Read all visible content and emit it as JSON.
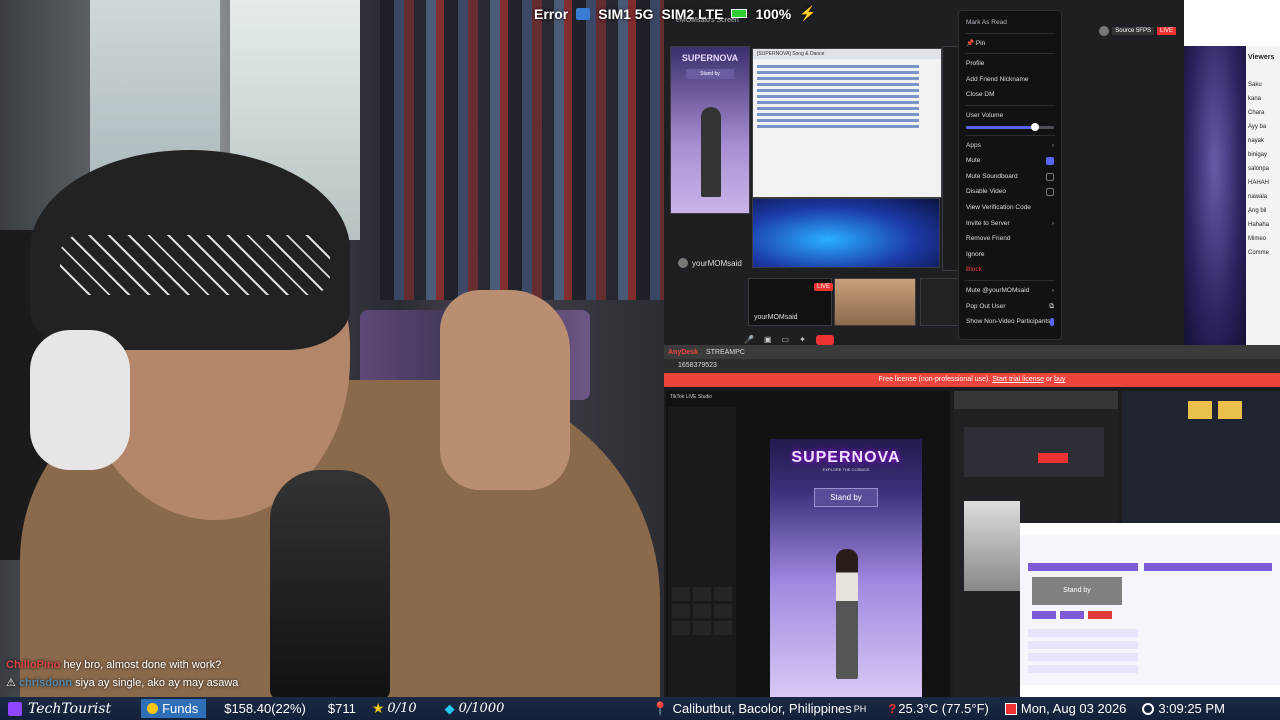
{
  "status_bar": {
    "error": "Error",
    "sim1": "SIM1 5G",
    "sim2": "SIM2 LTE",
    "battery": "100%",
    "screen_label": "eMOMsaid's Screen"
  },
  "chat": [
    {
      "user": "ChilloPino",
      "message": "hey bro, almost done with work?"
    },
    {
      "user": "chrisdonn",
      "message": "siya ay single, ako ay may asawa"
    }
  ],
  "discord": {
    "tile_phone_logo": "SUPERNOVA",
    "tile_phone_standby": "Stand by",
    "sheet_title": "[SUPERNOVA] Song & Dance",
    "participant_name": "yourMOMsaid",
    "participant_name_2": "yourMOMsaid",
    "live_badge": "LIVE",
    "source_badge": "Source 5FPS",
    "source_live": "LIVE",
    "context_menu": {
      "mark_as_read": "Mark As Read",
      "pin": "Pin",
      "profile": "Profile",
      "add_friend_nickname": "Add Friend Nickname",
      "close_dm": "Close DM",
      "user_volume": "User Volume",
      "user_volume_level": 0.78,
      "apps": "Apps",
      "mute": "Mute",
      "mute_soundboard": "Mute Soundboard",
      "disable_video": "Disable Video",
      "view_verification_code": "View Verification Code",
      "invite_to_server": "Invite to Server",
      "remove_friend": "Remove Friend",
      "ignore": "Ignore",
      "block": "Block",
      "mute_user": "Mute @yourMOMsaid",
      "pop_out_user": "Pop Out User",
      "show_non_video": "Show Non-Video Participants"
    }
  },
  "viewers": {
    "title": "Viewers",
    "names": [
      "Saku",
      "kana",
      "Chara",
      "Ayy ba",
      "nayak",
      "binigay",
      "salonpa",
      "HAHAH",
      "nawala",
      "Ang bil",
      "Hahaha",
      "Mimeo",
      "Comme"
    ]
  },
  "anydesk": {
    "app_name": "AnyDesk",
    "tab": "STREAMPC",
    "address": "1658379523",
    "banner_prefix": "Free license (non-professional use).",
    "banner_link": "Start trial license",
    "banner_or": "or",
    "banner_buy": "buy",
    "tiktok_title": "TikTok LIVE Studio",
    "supernova": "SUPERNOVA",
    "tagline": "EXPLORE THE COSMOS",
    "standby": "Stand by",
    "studio_standby": "Stand by"
  },
  "ticker": {
    "brand": "TechTourist",
    "funds_label": "Funds",
    "funds_value": "$158.40(22%)",
    "amount": "$711",
    "stars": "0/10",
    "gems": "0/1000",
    "location": "Calibutbut, Bacolor, Philippines",
    "location_code": "PH",
    "temperature": "25.3°C (77.5°F)",
    "date": "Mon, Aug 03 2026",
    "time": "3:09:25 PM"
  }
}
